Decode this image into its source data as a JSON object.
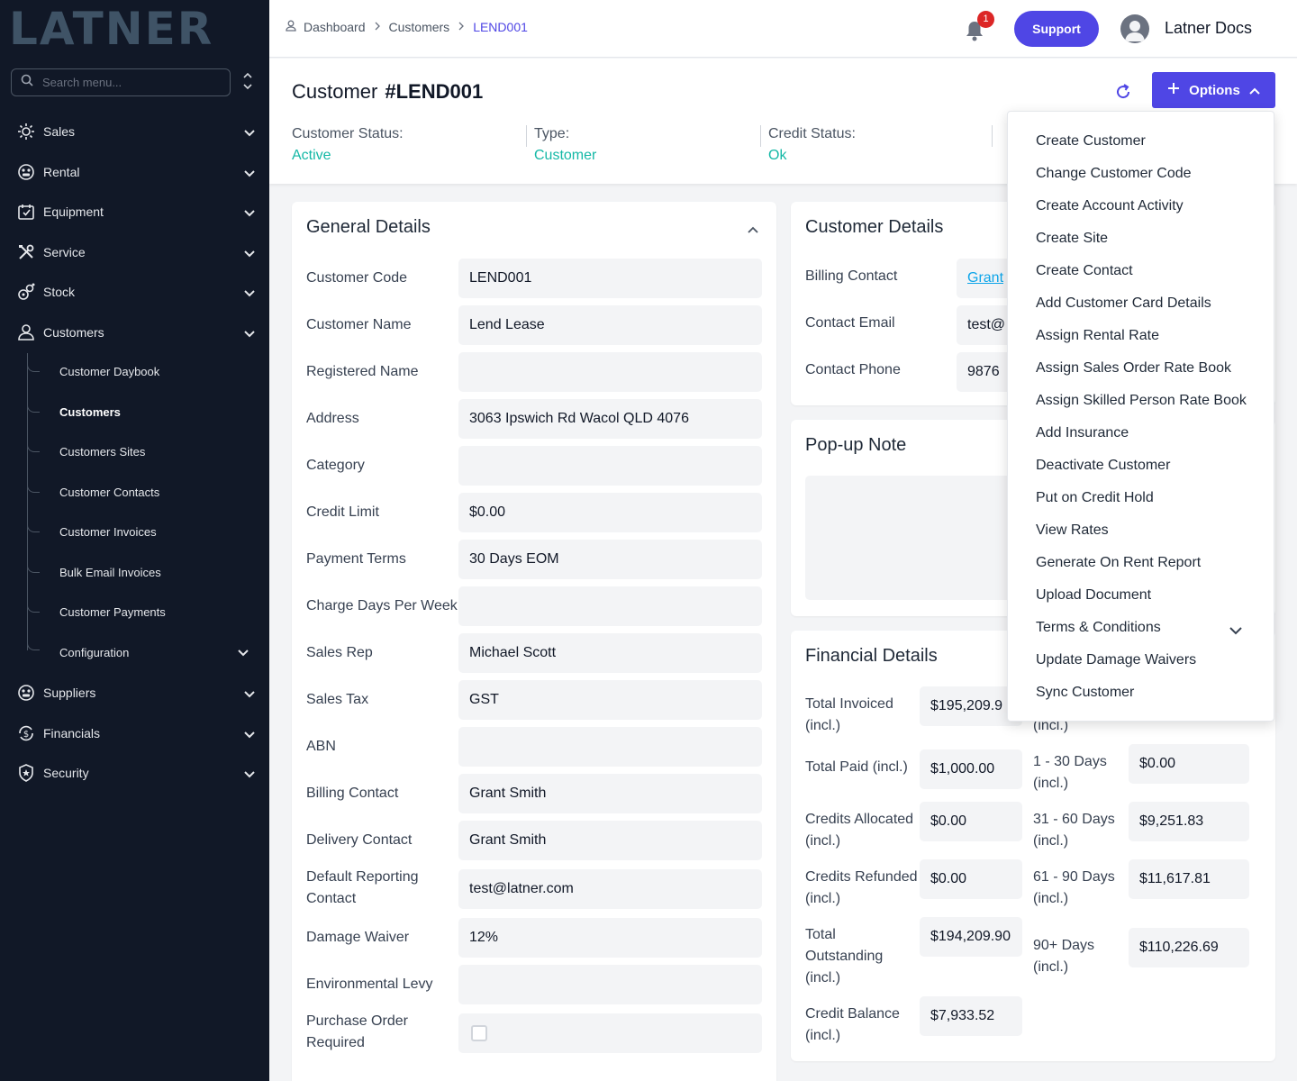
{
  "app": {
    "logo_text": "LATNER"
  },
  "sidebar": {
    "search_placeholder": "Search menu...",
    "items": [
      {
        "label": "Sales"
      },
      {
        "label": "Rental"
      },
      {
        "label": "Equipment"
      },
      {
        "label": "Service"
      },
      {
        "label": "Stock"
      },
      {
        "label": "Customers"
      },
      {
        "label": "Suppliers"
      },
      {
        "label": "Financials"
      },
      {
        "label": "Security"
      }
    ],
    "customers_sub": [
      {
        "label": "Customer Daybook"
      },
      {
        "label": "Customers"
      },
      {
        "label": "Customers Sites"
      },
      {
        "label": "Customer Contacts"
      },
      {
        "label": "Customer Invoices"
      },
      {
        "label": "Bulk Email Invoices"
      },
      {
        "label": "Customer Payments"
      },
      {
        "label": "Configuration"
      }
    ]
  },
  "header": {
    "breadcrumb": [
      "Dashboard",
      "Customers",
      "LEND001"
    ],
    "notification_count": "1",
    "support_label": "Support",
    "user_name": "Latner Docs"
  },
  "page": {
    "title_prefix": "Customer",
    "title_code": "#LEND001",
    "options_label": "Options",
    "stats": [
      {
        "label": "Customer Status:",
        "value": "Active"
      },
      {
        "label": "Type:",
        "value": "Customer"
      },
      {
        "label": "Credit Status:",
        "value": "Ok"
      }
    ]
  },
  "general_details": {
    "title": "General Details",
    "fields": [
      {
        "label": "Customer Code",
        "value": "LEND001"
      },
      {
        "label": "Customer Name",
        "value": "Lend Lease"
      },
      {
        "label": "Registered Name",
        "value": ""
      },
      {
        "label": "Address",
        "value": "3063 Ipswich Rd Wacol QLD 4076"
      },
      {
        "label": "Category",
        "value": ""
      },
      {
        "label": "Credit Limit",
        "value": "$0.00"
      },
      {
        "label": "Payment Terms",
        "value": "30 Days EOM"
      },
      {
        "label": "Charge Days Per Week",
        "value": ""
      },
      {
        "label": "Sales Rep",
        "value": "Michael Scott"
      },
      {
        "label": "Sales Tax",
        "value": "GST"
      },
      {
        "label": "ABN",
        "value": ""
      },
      {
        "label": "Billing Contact",
        "value": "Grant Smith"
      },
      {
        "label": "Delivery Contact",
        "value": "Grant Smith"
      },
      {
        "label": "Default Reporting Contact",
        "value": "test@latner.com"
      },
      {
        "label": "Damage Waiver",
        "value": "12%"
      },
      {
        "label": "Environmental Levy",
        "value": ""
      },
      {
        "label": "Purchase Order Required",
        "value": ""
      }
    ]
  },
  "customer_details": {
    "title": "Customer Details",
    "fields": [
      {
        "label": "Billing Contact",
        "value": "Grant"
      },
      {
        "label": "Contact Email",
        "value": "test@"
      },
      {
        "label": "Contact Phone",
        "value": "9876"
      }
    ]
  },
  "popup_note": {
    "title": "Pop-up Note"
  },
  "financial_details": {
    "title": "Financial Details",
    "left": [
      {
        "label_1": "Total Invoiced",
        "label_2": "(incl.)",
        "value": "$195,209.9"
      },
      {
        "label_1": "Total Paid (incl.)",
        "label_2": "",
        "value": "$1,000.00"
      },
      {
        "label_1": "Credits Allocated",
        "label_2": "(incl.)",
        "value": "$0.00"
      },
      {
        "label_1": "Credits Refunded",
        "label_2": "(incl.)",
        "value": "$0.00"
      },
      {
        "label_1": "Total",
        "label_2": "Outstanding",
        "label_3": "(incl.)",
        "value": "$194,209.90"
      },
      {
        "label_1": "Credit Balance",
        "label_2": "(incl.)",
        "value": "$7,933.52"
      }
    ],
    "right": [
      {
        "label_1": "",
        "label_2": "(incl.)",
        "value": ""
      },
      {
        "label_1": "1 - 30 Days",
        "label_2": "(incl.)",
        "value": "$0.00"
      },
      {
        "label_1": "31 - 60 Days",
        "label_2": "(incl.)",
        "value": "$9,251.83"
      },
      {
        "label_1": "61 - 90 Days",
        "label_2": "(incl.)",
        "value": "$11,617.81"
      },
      {
        "label_1": "90+ Days",
        "label_2": "(incl.)",
        "value": "$110,226.69"
      }
    ]
  },
  "options_menu": [
    "Create Customer",
    "Change Customer Code",
    "Create Account Activity",
    "Create Site",
    "Create Contact",
    "Add Customer Card Details",
    "Assign Rental Rate",
    "Assign Sales Order Rate Book",
    "Assign Skilled Person Rate Book",
    "Add Insurance",
    "Deactivate Customer",
    "Put on Credit Hold",
    "View Rates",
    "Generate On Rent Report",
    "Upload Document",
    "Terms & Conditions",
    "Update Damage Waivers",
    "Sync Customer"
  ],
  "colors": {
    "sidebar_bg": "#111827",
    "accent": "#4f46e5",
    "status_green": "#14b8a6",
    "badge_red": "#dc2626"
  }
}
